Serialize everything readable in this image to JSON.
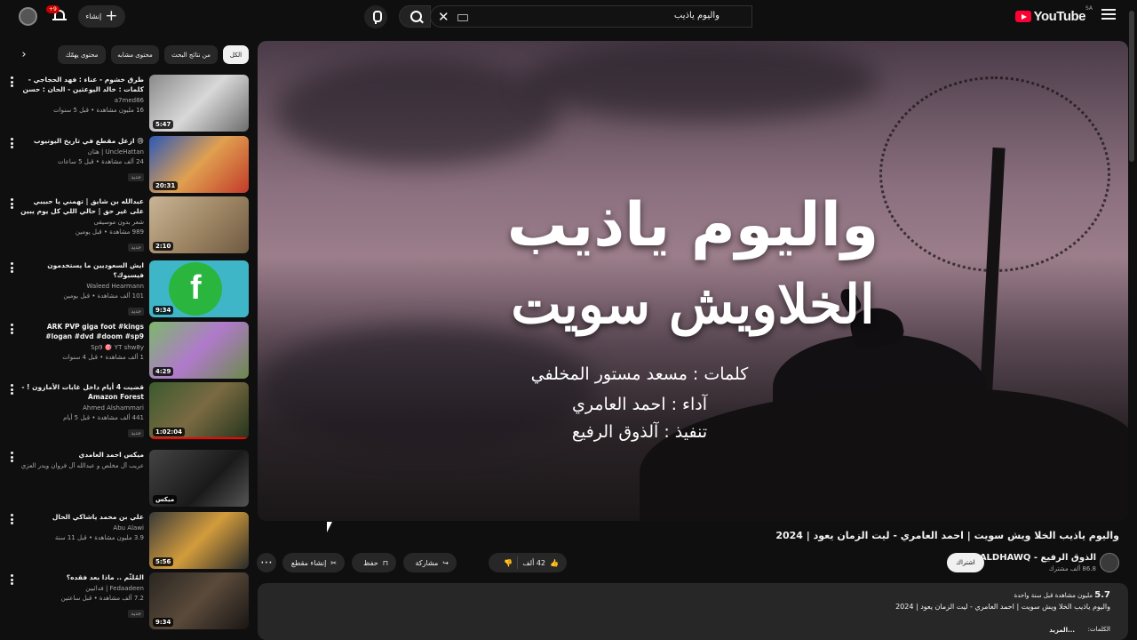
{
  "header": {
    "logo_text": "YouTube",
    "region": "SA",
    "search_query": "واليوم ياذيب",
    "create_label": "إنشاء",
    "notification_badge": "+9"
  },
  "player": {
    "overlay_title_1": "واليوم ياذيب",
    "overlay_title_2": "الخلاويش سويت",
    "credit_lyrics": "كلمات : مسعد مستور المخلفي",
    "credit_performer": "آداء : احمد العامري",
    "credit_production": "تنفيذ : آلذوق الرفيع"
  },
  "video": {
    "title": "واليوم ياذيب الخلا ويش سويت | احمد العامري - ليت الزمان يعود | 2024",
    "channel_name": "الذوق الرفيع - ALDHAWQ",
    "channel_subs": "86.8 ألف مشترك",
    "subscribe_label": "اشتراك",
    "likes": "42 ألف",
    "share_label": "مشاركة",
    "save_label": "حفظ",
    "clip_label": "إنشاء مقطع",
    "views": "5.7",
    "views_suffix": "مليون مشاهدة  قبل سنة واحدة",
    "description_line": "واليوم ياذيب الخلا ويش سويت | احمد العامري - ليت الزمان يعود | 2024",
    "description_lyrics": "الكلمات:",
    "more_label": "...المزيد"
  },
  "chips": [
    {
      "label": "الكل",
      "active": true
    },
    {
      "label": "من نتائج البحث",
      "active": false
    },
    {
      "label": "محتوى مشابه",
      "active": false
    },
    {
      "label": "محتوى يهمّك",
      "active": false
    }
  ],
  "recommendations": [
    {
      "title": "طرق خشوم - عناء : فهد الحجاجي - كلمات : خالد اليوعثين - الحان : حسن حامد",
      "channel": "a7med86",
      "meta": "16 مليون مشاهدة • قبل 5 سنوات",
      "badge": "",
      "duration": "5:47"
    },
    {
      "title": "😢 ازعل مقطع في تاريخ اليوتيوب",
      "channel": "UncleHattan | هتان",
      "meta": "24 ألف مشاهدة • قبل 5 ساعات",
      "badge": "جديد",
      "duration": "20:31"
    },
    {
      "title": "عبدالله بن شايق | تهمني يا حبيبي على غير حق | حالي اللي كل يوم يبين النقص فيها يا ...",
      "channel": "شعر بدون موسيقى",
      "meta": "989 مشاهدة • قبل يومين",
      "badge": "جديد",
      "duration": "2:10"
    },
    {
      "title": "ايش السعوديين ما يستخدمون فيسبوك؟",
      "channel": "Waleed Hearmann",
      "meta": "101 ألف مشاهدة • قبل يومين",
      "badge": "جديد",
      "duration": "9:34"
    },
    {
      "title": "ARK PVP giga foot #kings #logan #dvd #doom #sp9",
      "channel": "Sp9 🎯 YT shw8y",
      "meta": "1 ألف مشاهدة • قبل 4 سنوات",
      "badge": "",
      "duration": "4:29"
    },
    {
      "title": "قضيت 4 أيام داخل غابات الأمازون ! - Amazon Forest",
      "channel": "Ahmed Alshammari",
      "meta": "441 ألف مشاهدة • قبل 5 أيام",
      "badge": "جديد",
      "duration": "1:02:04"
    },
    {
      "title": "ميكس احمد العامدي",
      "channel": "عريب آل مخلص و عبدالله آل فروان ويدر العزي وفلاوي آل...",
      "meta": "",
      "badge": "",
      "duration": "ميكس"
    },
    {
      "title": "علي بن محمد ياشاكي الحال",
      "channel": "Abu Alawi",
      "meta": "3.9 مليون مشاهدة • قبل 11 سنة",
      "badge": "",
      "duration": "5:56"
    },
    {
      "title": "المُلثّم .. ماذا بعد فقده؟",
      "channel": "Fedaadeen | فدائيين",
      "meta": "7.2 ألف مشاهدة • قبل ساعتين",
      "badge": "جديد",
      "duration": "9:34"
    }
  ],
  "colors": {
    "background": "#0f0f0f",
    "accent": "#ff0000",
    "chip_active": "#f1f1f1"
  }
}
